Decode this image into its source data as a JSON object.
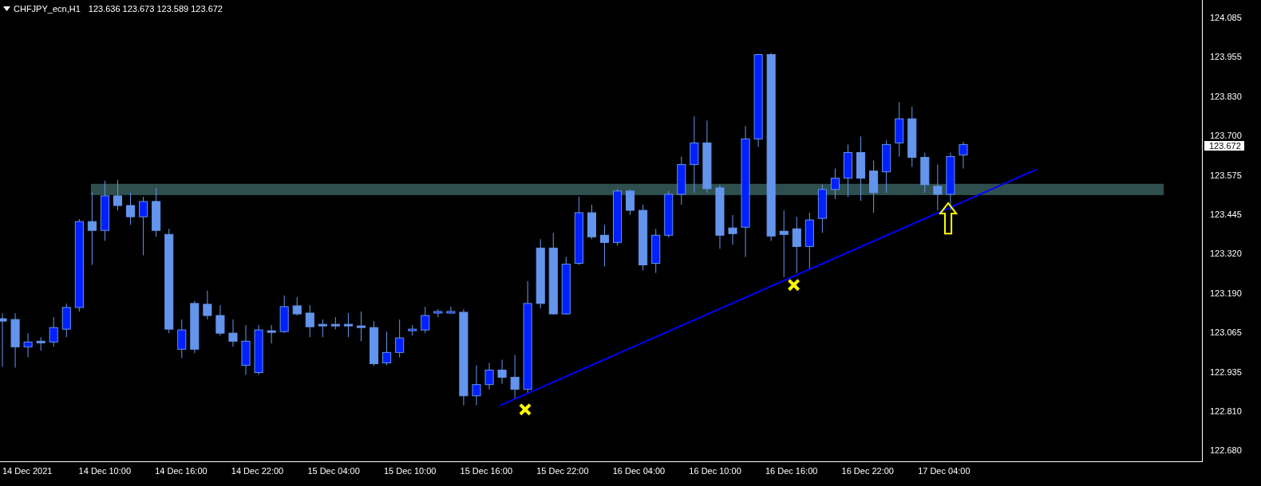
{
  "chart_header": {
    "symbol": "CHFJPY_ecn,H1",
    "quotes": "123.636 123.673 123.589 123.672"
  },
  "price_axis": {
    "labels": [
      "124.085",
      "123.955",
      "123.830",
      "123.700",
      "123.575",
      "123.445",
      "123.320",
      "123.190",
      "123.065",
      "122.935",
      "122.810",
      "122.680"
    ],
    "current_price": "123.672"
  },
  "time_axis": {
    "labels": [
      "14 Dec 2021",
      "14 Dec 10:00",
      "14 Dec 16:00",
      "14 Dec 22:00",
      "15 Dec 04:00",
      "15 Dec 10:00",
      "15 Dec 16:00",
      "15 Dec 22:00",
      "16 Dec 04:00",
      "16 Dec 10:00",
      "16 Dec 16:00",
      "16 Dec 22:00",
      "17 Dec 04:00"
    ]
  }
}
